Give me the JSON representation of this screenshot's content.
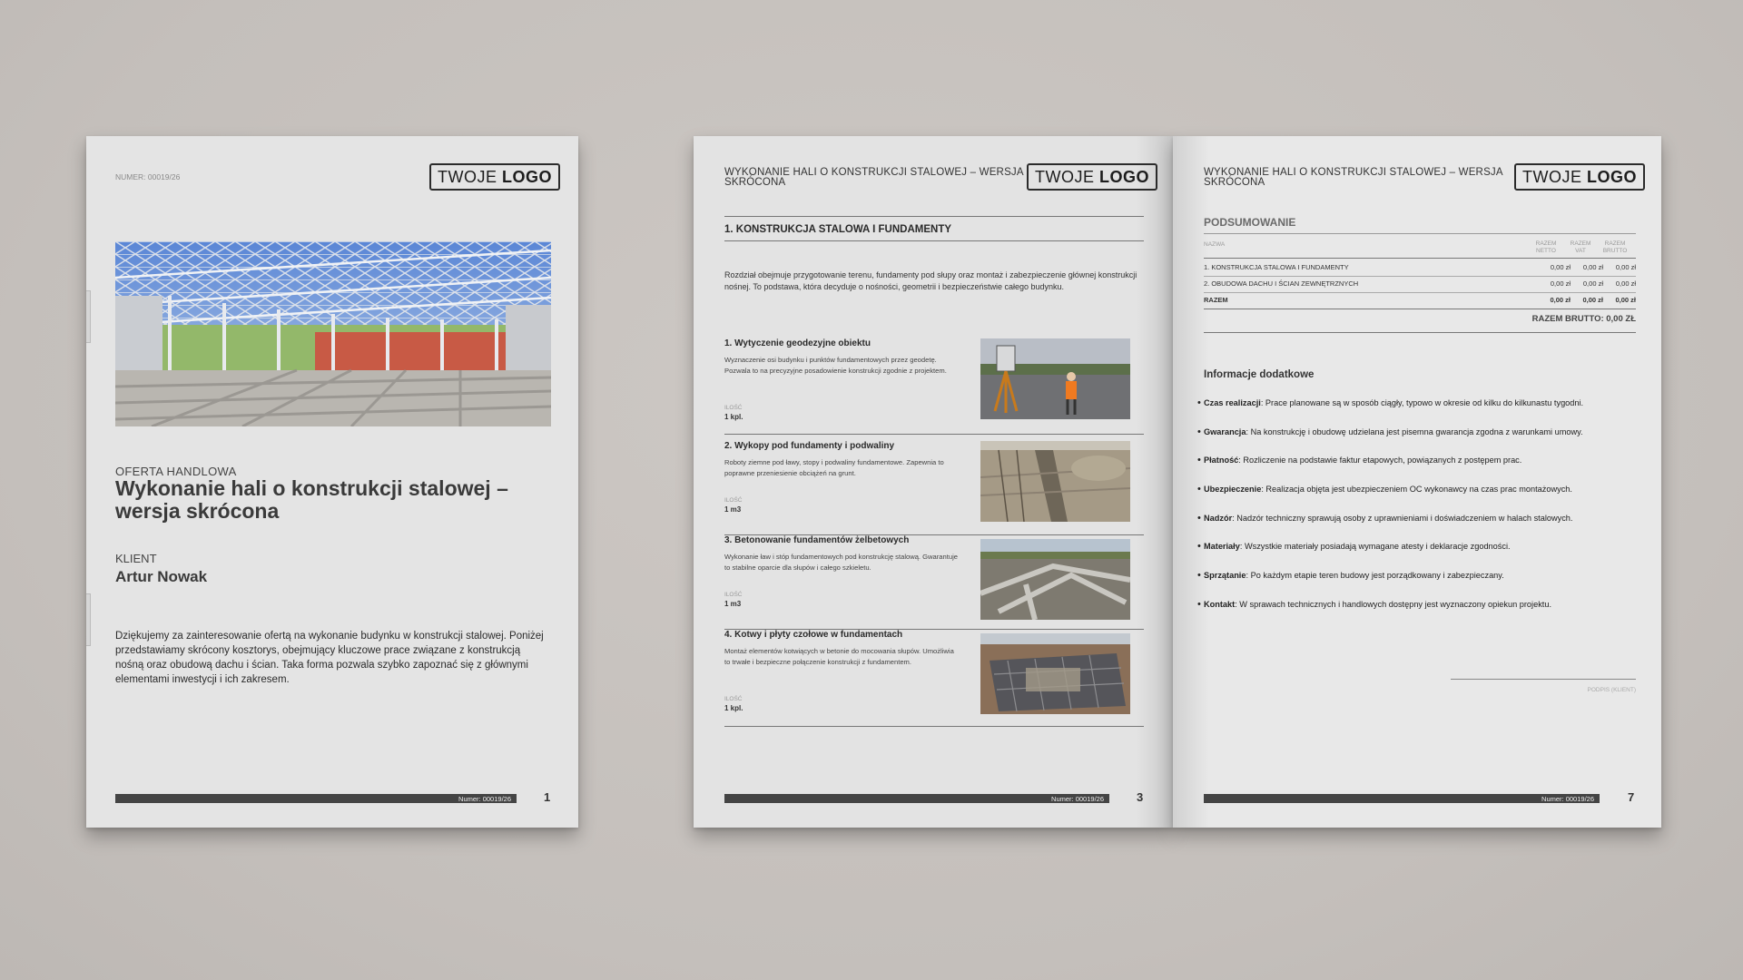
{
  "cover": {
    "doc_number": "NUMER: 00019/26",
    "logo_light": "TWOJE ",
    "logo_bold": "LOGO",
    "kicker": "OFERTA HANDLOWA",
    "title": "Wykonanie hali o konstrukcji stalowej – wersja skrócona",
    "client_label": "KLIENT",
    "client_name": "Artur Nowak",
    "intro": "Dziękujemy za zainteresowanie ofertą na wykonanie budynku w konstrukcji stalowej. Poniżej przedstawiamy skrócony kosztorys, obejmujący kluczowe prace związane z konstrukcją nośną oraz obudową dachu i ścian. Taka forma pozwala szybko zapoznać się z głównymi elementami inwestycji i ich zakresem.",
    "footer_number": "Numer: 00019/26",
    "page_number": "1"
  },
  "page3": {
    "running_head": "WYKONANIE HALI O KONSTRUKCJI STALOWEJ – WERSJA SKRÓCONA",
    "logo_light": "TWOJE ",
    "logo_bold": "LOGO",
    "section_title": "1. KONSTRUKCJA STALOWA I FUNDAMENTY",
    "section_intro": "Rozdział obejmuje przygotowanie terenu, fundamenty pod słupy oraz montaż i zabezpieczenie głównej konstrukcji nośnej. To podstawa, która decyduje o nośności, geometrii i bezpieczeństwie całego budynku.",
    "quantity_label": "ILOŚĆ",
    "items": [
      {
        "title": "1. Wytyczenie geodezyjne obiektu",
        "desc": "Wyznaczenie osi budynku i punktów fundamentowych przez geodetę. Pozwala to na precyzyjne posadowienie konstrukcji zgodnie z projektem.",
        "qty": "1 kpl."
      },
      {
        "title": "2. Wykopy pod fundamenty i podwaliny",
        "desc": "Roboty ziemne pod ławy, stopy i podwaliny fundamentowe. Zapewnia to poprawne przeniesienie obciążeń na grunt.",
        "qty": "1 m3"
      },
      {
        "title": "3. Betonowanie fundamentów żelbetowych",
        "desc": "Wykonanie ław i stóp fundamentowych pod konstrukcję stalową. Gwarantuje to stabilne oparcie dla słupów i całego szkieletu.",
        "qty": "1 m3"
      },
      {
        "title": "4. Kotwy i płyty czołowe w fundamentach",
        "desc": "Montaż elementów kotwiących w betonie do mocowania słupów. Umożliwia to trwałe i bezpieczne połączenie konstrukcji z fundamentem.",
        "qty": "1 kpl."
      }
    ],
    "footer_number": "Numer: 00019/26",
    "page_number": "3"
  },
  "page7": {
    "running_head": "WYKONANIE HALI O KONSTRUKCJI STALOWEJ – WERSJA SKRÓCONA",
    "logo_light": "TWOJE ",
    "logo_bold": "LOGO",
    "summary_title": "PODSUMOWANIE",
    "table_headers": {
      "name": "NAZWA",
      "net": "RAZEM NETTO",
      "vat": "RAZEM VAT",
      "gross": "RAZEM BRUTTO"
    },
    "table_rows": [
      {
        "name": "1. KONSTRUKCJA STALOWA I FUNDAMENTY",
        "net": "0,00 zł",
        "vat": "0,00 zł",
        "gross": "0,00 zł"
      },
      {
        "name": "2. OBUDOWA DACHU I ŚCIAN ZEWNĘTRZNYCH",
        "net": "0,00 zł",
        "vat": "0,00 zł",
        "gross": "0,00 zł"
      }
    ],
    "total_row": {
      "name": "RAZEM",
      "net": "0,00 zł",
      "vat": "0,00 zł",
      "gross": "0,00 zł"
    },
    "grand_total": "RAZEM BRUTTO: 0,00 ZŁ",
    "info_title": "Informacje dodatkowe",
    "info": [
      {
        "label": "Czas realizacji",
        "text": ": Prace planowane są w sposób ciągły, typowo w okresie od kilku do kilkunastu tygodni."
      },
      {
        "label": "Gwarancja",
        "text": ": Na konstrukcję i obudowę udzielana jest pisemna gwarancja zgodna z warunkami umowy."
      },
      {
        "label": "Płatność",
        "text": ": Rozliczenie na podstawie faktur etapowych, powiązanych z postępem prac."
      },
      {
        "label": "Ubezpieczenie",
        "text": ": Realizacja objęta jest ubezpieczeniem OC wykonawcy na czas prac montażowych."
      },
      {
        "label": "Nadzór",
        "text": ": Nadzór techniczny sprawują osoby z uprawnieniami i doświadczeniem w halach stalowych."
      },
      {
        "label": "Materiały",
        "text": ": Wszystkie materiały posiadają wymagane atesty i deklaracje zgodności."
      },
      {
        "label": "Sprzątanie",
        "text": ": Po każdym etapie teren budowy jest porządkowany i zabezpieczany."
      },
      {
        "label": "Kontakt",
        "text": ": W sprawach technicznych i handlowych dostępny jest wyznaczony opiekun projektu."
      }
    ],
    "signature_label": "PODPIS (KLIENT)",
    "footer_number": "Numer: 00019/26",
    "page_number": "7"
  }
}
